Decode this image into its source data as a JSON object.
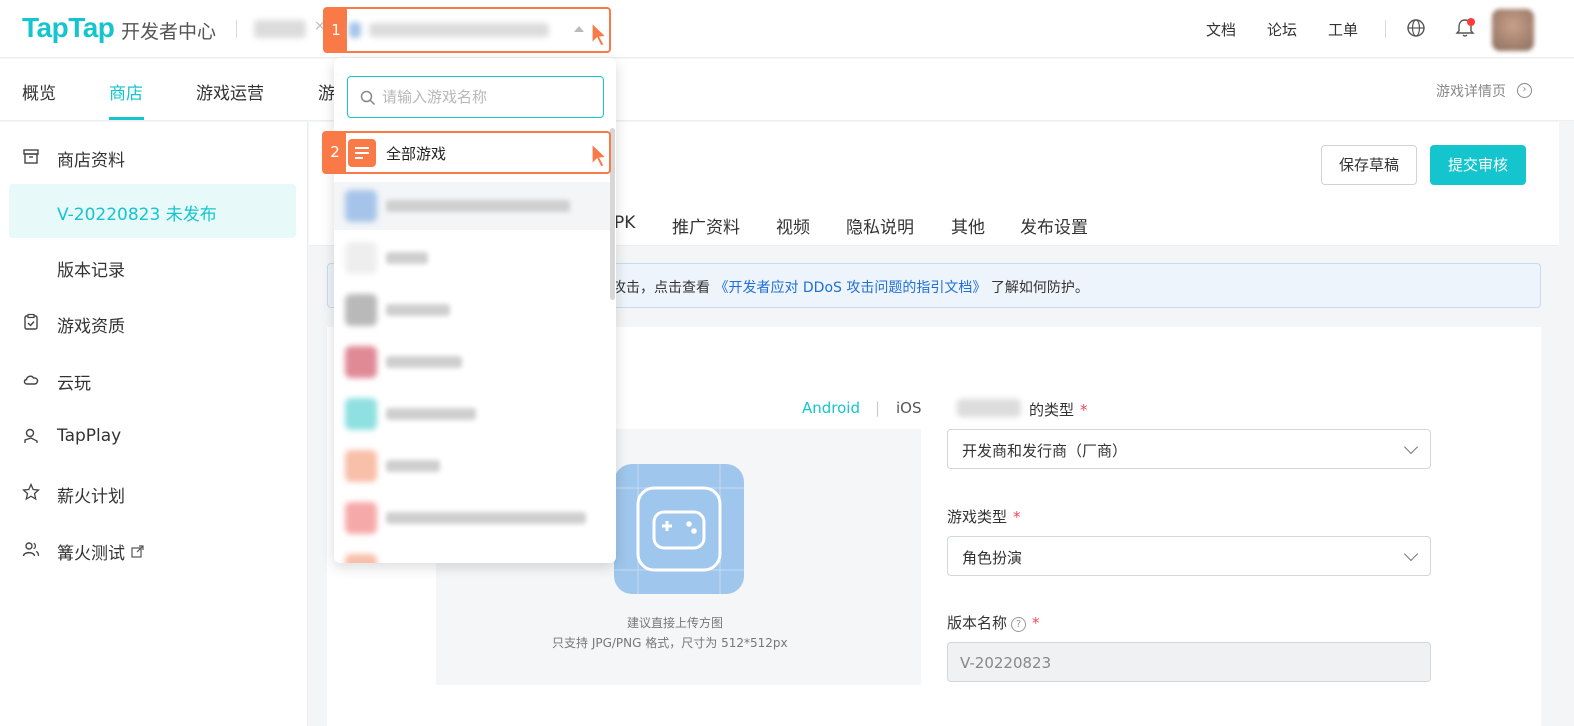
{
  "header": {
    "logo": "TapTap",
    "subtitle": "开发者中心",
    "links": [
      "文档",
      "论坛",
      "工单"
    ]
  },
  "selector": {
    "step": "1"
  },
  "dropdown": {
    "search_placeholder": "请输入游戏名称",
    "all_games": {
      "step": "2",
      "label": "全部游戏"
    }
  },
  "nav": {
    "items": [
      "概览",
      "商店",
      "游戏运营",
      "游"
    ],
    "active": "商店",
    "detail_link": "游戏详情页"
  },
  "sidebar": {
    "items": [
      "商店资料",
      "V-20220823 未发布",
      "版本记录",
      "游戏资质",
      "云玩",
      "TapPlay",
      "薪火计划",
      "篝火测试"
    ]
  },
  "actions": {
    "save_draft": "保存草稿",
    "submit_review": "提交审核"
  },
  "sub_tabs": [
    "PK",
    "推广资料",
    "视频",
    "隐私说明",
    "其他",
    "发布设置"
  ],
  "notice": {
    "text_before": "攻击，点击查看",
    "link": "《开发者应对 DDoS 攻击问题的指引文档》",
    "text_after": "了解如何防护。"
  },
  "platforms": {
    "android": "Android",
    "ios": "iOS"
  },
  "upload": {
    "hint1": "建议直接上传方图",
    "hint2": "只支持 JPG/PNG 格式，尺寸为 512*512px"
  },
  "form": {
    "type_label": "的类型",
    "type_value": "开发商和发行商（厂商）",
    "game_type_label": "游戏类型",
    "game_type_value": "角色扮演",
    "version_label": "版本名称",
    "version_value": "V-20220823",
    "required_mark": "*"
  },
  "colors": {
    "brand": "#15c5ce",
    "highlight": "#fa7a47",
    "link": "#1f6fd6"
  }
}
